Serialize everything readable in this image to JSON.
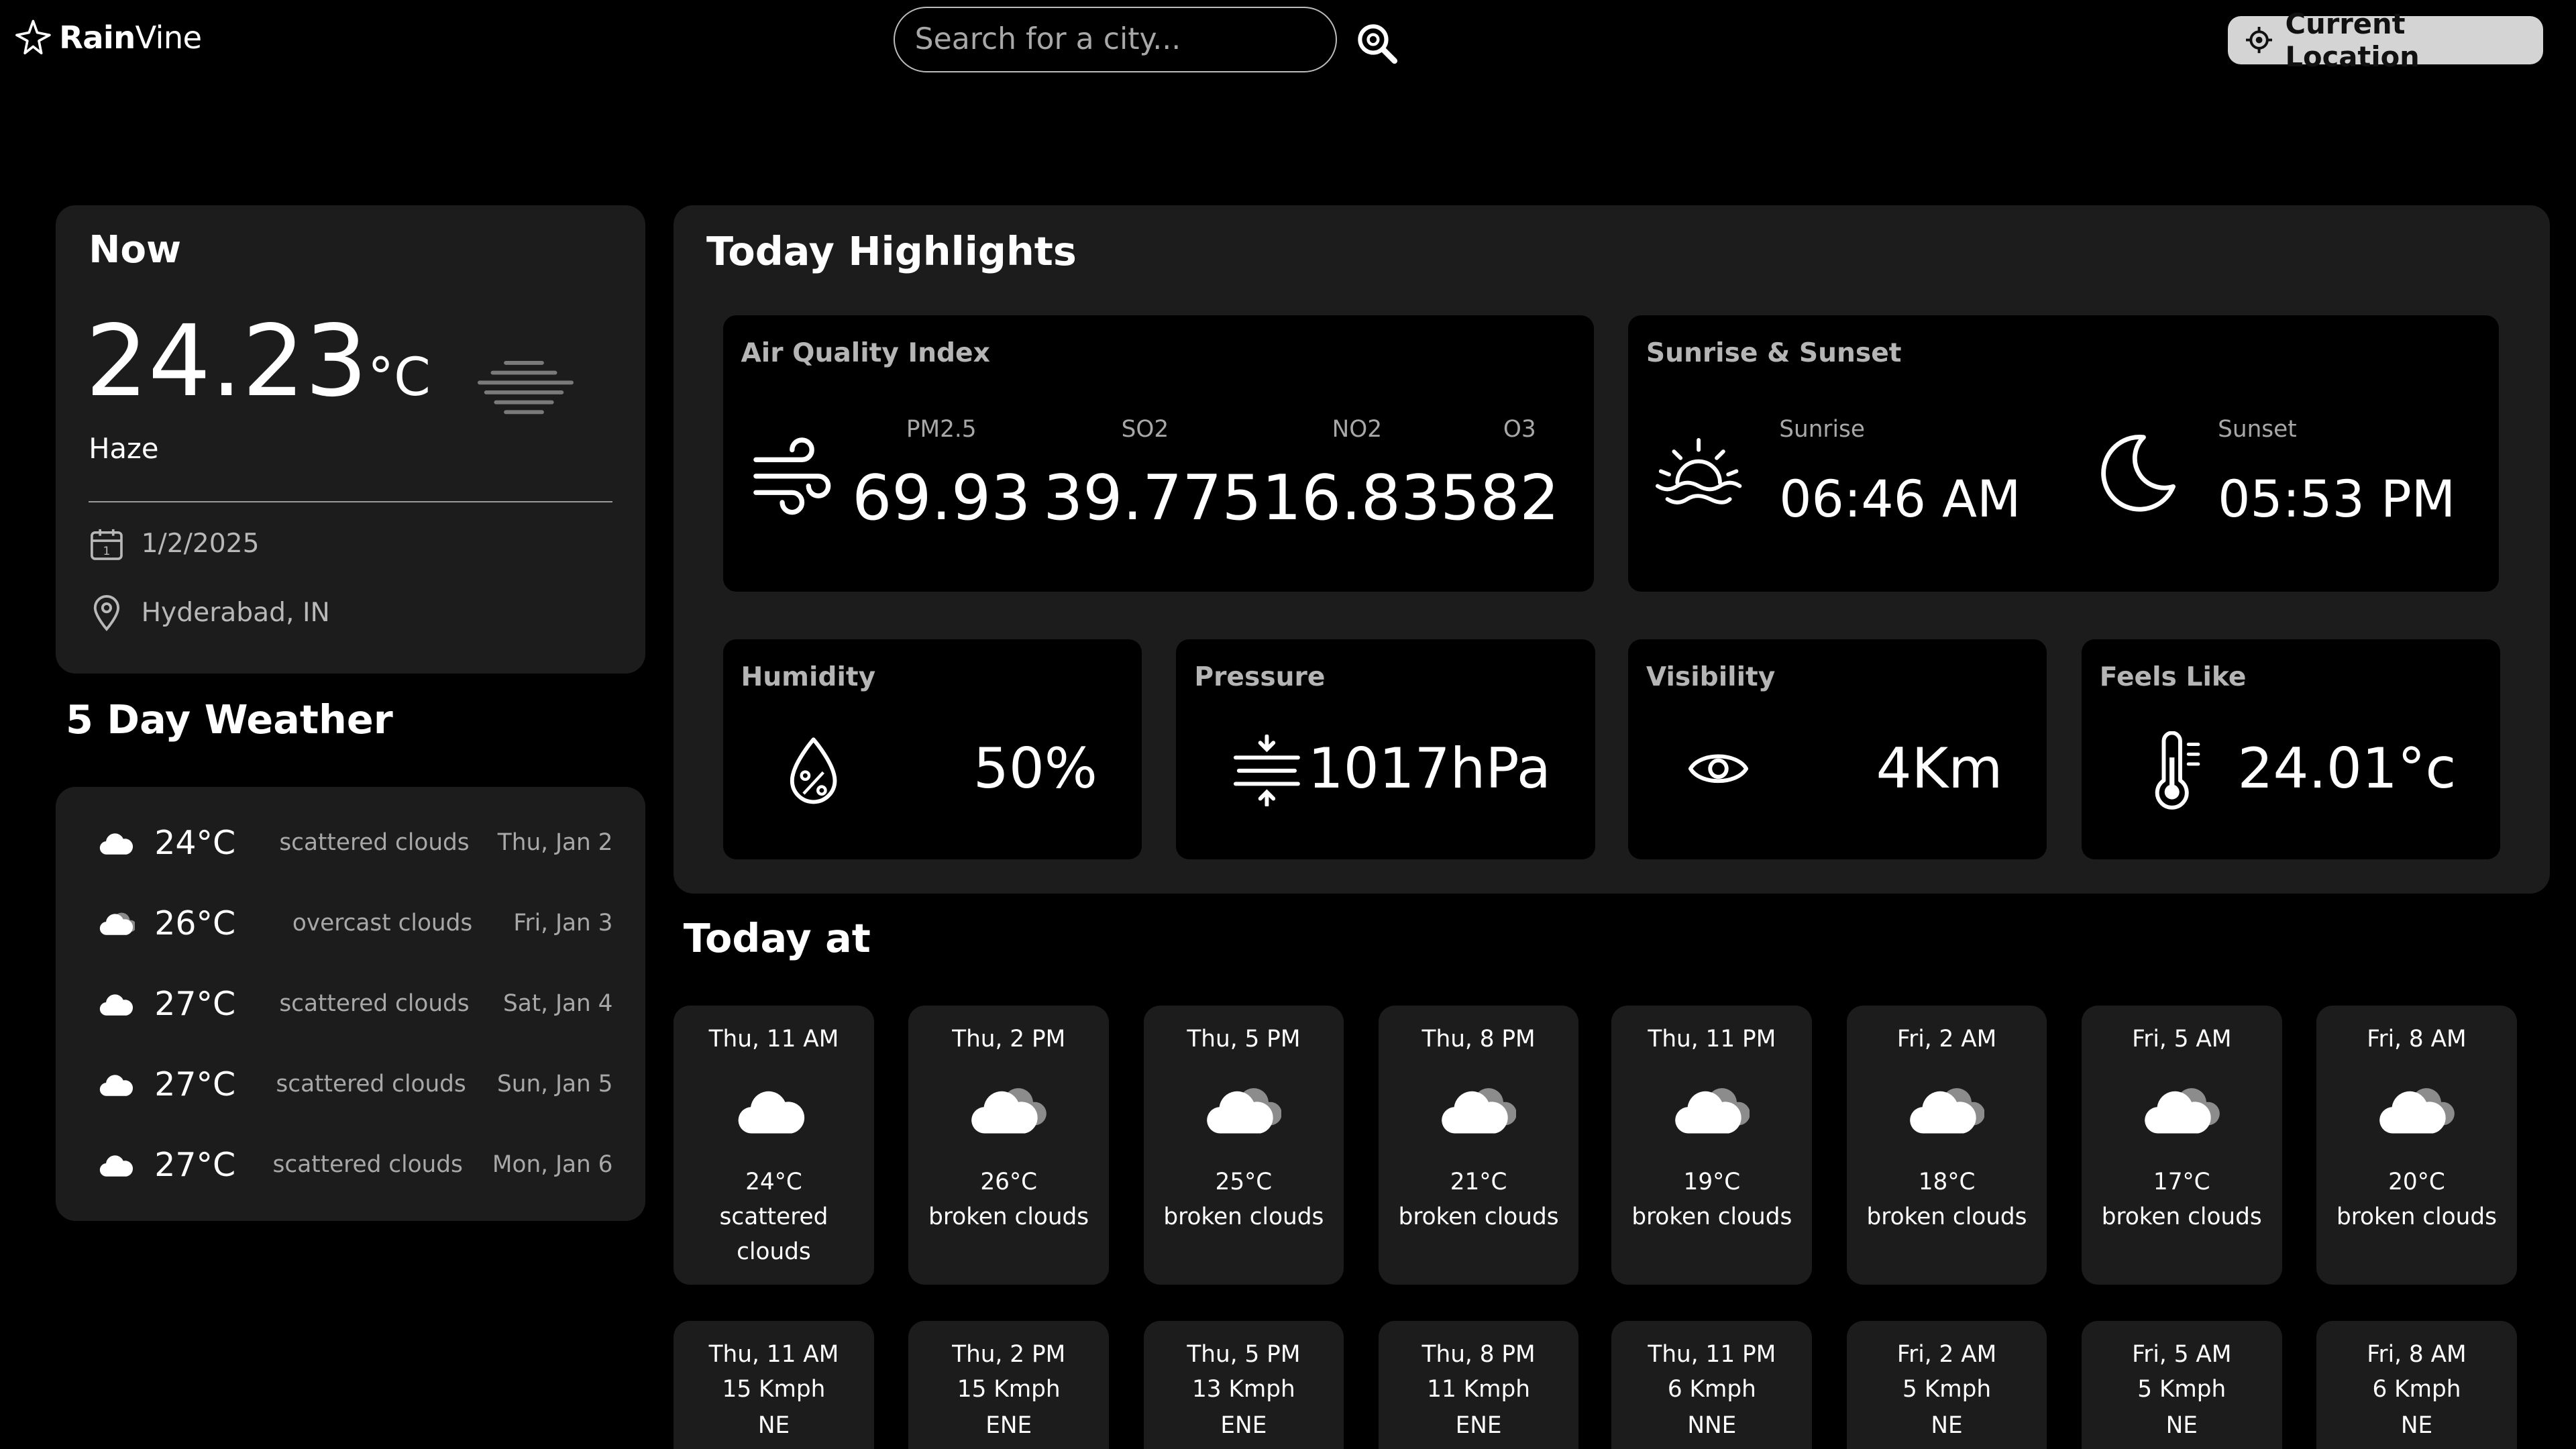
{
  "header": {
    "logo_bold": "Rain",
    "logo_rest": "Vine",
    "search_placeholder": "Search for a city...",
    "location_button": "Current Location"
  },
  "now": {
    "title": "Now",
    "temp_value": "24.23",
    "temp_unit": "°C",
    "condition": "Haze",
    "date": "1/2/2025",
    "location": "Hyderabad, IN"
  },
  "five_day": {
    "title": "5 Day Weather",
    "days": [
      {
        "temp": "24°C",
        "desc": "scattered clouds",
        "date": "Thu, Jan 2"
      },
      {
        "temp": "26°C",
        "desc": "overcast clouds",
        "date": "Fri, Jan 3"
      },
      {
        "temp": "27°C",
        "desc": "scattered clouds",
        "date": "Sat, Jan 4"
      },
      {
        "temp": "27°C",
        "desc": "scattered clouds",
        "date": "Sun, Jan 5"
      },
      {
        "temp": "27°C",
        "desc": "scattered clouds",
        "date": "Mon, Jan 6"
      }
    ]
  },
  "highlights": {
    "title": "Today Highlights",
    "aqi": {
      "title": "Air Quality Index",
      "items": [
        {
          "label": "PM2.5",
          "value": "69.93"
        },
        {
          "label": "SO2",
          "value": "39.775"
        },
        {
          "label": "NO2",
          "value": "16.835"
        },
        {
          "label": "O3",
          "value": "82"
        }
      ]
    },
    "sun": {
      "title": "Sunrise & Sunset",
      "sunrise_label": "Sunrise",
      "sunrise": "06:46 AM",
      "sunset_label": "Sunset",
      "sunset": "05:53 PM"
    },
    "humidity": {
      "title": "Humidity",
      "value": "50%"
    },
    "pressure": {
      "title": "Pressure",
      "value": "1017hPa"
    },
    "visibility": {
      "title": "Visibility",
      "value": "4Km"
    },
    "feels_like": {
      "title": "Feels Like",
      "value": "24.01°c"
    }
  },
  "today_at": {
    "title": "Today at",
    "hourly": [
      {
        "time": "Thu, 11 AM",
        "temp": "24°C",
        "desc": "scattered clouds",
        "icon": "cloud-icon"
      },
      {
        "time": "Thu, 2 PM",
        "temp": "26°C",
        "desc": "broken clouds",
        "icon": "broken-clouds-icon"
      },
      {
        "time": "Thu, 5 PM",
        "temp": "25°C",
        "desc": "broken clouds",
        "icon": "broken-clouds-icon"
      },
      {
        "time": "Thu, 8 PM",
        "temp": "21°C",
        "desc": "broken clouds",
        "icon": "broken-clouds-icon"
      },
      {
        "time": "Thu, 11 PM",
        "temp": "19°C",
        "desc": "broken clouds",
        "icon": "broken-clouds-icon"
      },
      {
        "time": "Fri, 2 AM",
        "temp": "18°C",
        "desc": "broken clouds",
        "icon": "broken-clouds-icon"
      },
      {
        "time": "Fri, 5 AM",
        "temp": "17°C",
        "desc": "broken clouds",
        "icon": "broken-clouds-icon"
      },
      {
        "time": "Fri, 8 AM",
        "temp": "20°C",
        "desc": "broken clouds",
        "icon": "broken-clouds-icon"
      }
    ],
    "wind": [
      {
        "time": "Thu, 11 AM",
        "speed": "15 Kmph",
        "dir": "NE"
      },
      {
        "time": "Thu, 2 PM",
        "speed": "15 Kmph",
        "dir": "ENE"
      },
      {
        "time": "Thu, 5 PM",
        "speed": "13 Kmph",
        "dir": "ENE"
      },
      {
        "time": "Thu, 8 PM",
        "speed": "11 Kmph",
        "dir": "ENE"
      },
      {
        "time": "Thu, 11 PM",
        "speed": "6 Kmph",
        "dir": "NNE"
      },
      {
        "time": "Fri, 2 AM",
        "speed": "5 Kmph",
        "dir": "NE"
      },
      {
        "time": "Fri, 5 AM",
        "speed": "5 Kmph",
        "dir": "NE"
      },
      {
        "time": "Fri, 8 AM",
        "speed": "6 Kmph",
        "dir": "NE"
      }
    ]
  }
}
